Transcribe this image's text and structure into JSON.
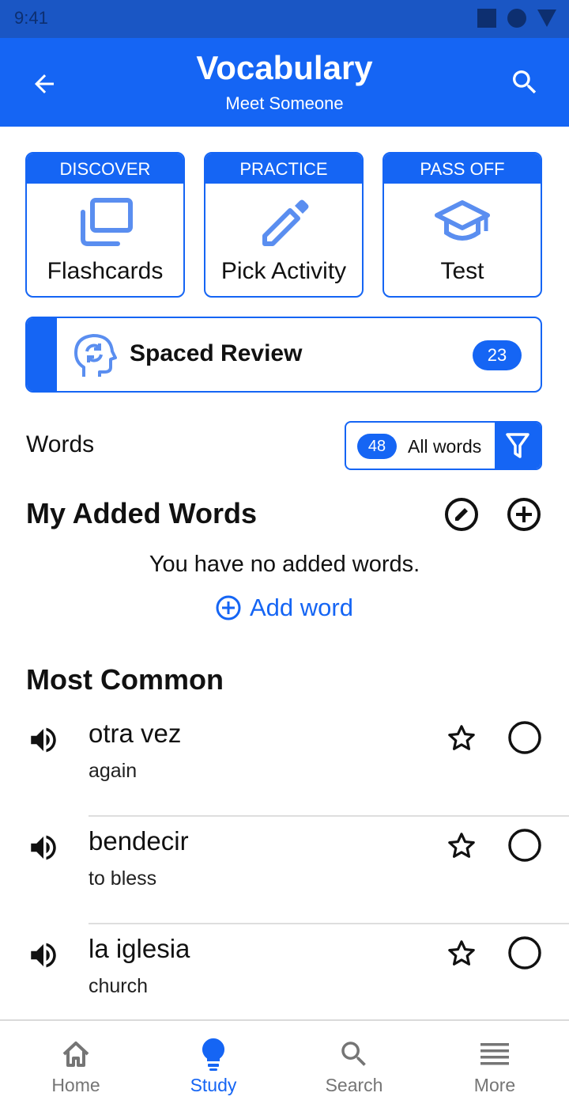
{
  "status_bar": {
    "time": "9:41"
  },
  "header": {
    "title": "Vocabulary",
    "subtitle": "Meet Someone",
    "back_icon": "arrow-left-icon",
    "search_icon": "search-icon"
  },
  "modes": [
    {
      "category": "DISCOVER",
      "label": "Flashcards",
      "icon": "cards-icon"
    },
    {
      "category": "PRACTICE",
      "label": "Pick Activity",
      "icon": "pencil-icon"
    },
    {
      "category": "PASS OFF",
      "label": "Test",
      "icon": "graduation-cap-icon"
    }
  ],
  "spaced_review": {
    "label": "Spaced Review",
    "count": "23",
    "icon": "head-refresh-icon"
  },
  "words": {
    "label": "Words",
    "count": "48",
    "filter_label": "All words",
    "filter_icon": "filter-icon"
  },
  "my_added_words": {
    "title": "My Added Words",
    "empty_message": "You have no added words.",
    "add_label": "Add word"
  },
  "most_common": {
    "title": "Most Common",
    "items": [
      {
        "term": "otra vez",
        "definition": "again"
      },
      {
        "term": "bendecir",
        "definition": "to bless"
      },
      {
        "term": "la iglesia",
        "definition": "church"
      }
    ]
  },
  "bottom_nav": {
    "items": [
      {
        "label": "Home",
        "icon": "home-icon"
      },
      {
        "label": "Study",
        "icon": "lightbulb-icon",
        "active": true
      },
      {
        "label": "Search",
        "icon": "search-icon"
      },
      {
        "label": "More",
        "icon": "menu-icon"
      }
    ]
  },
  "colors": {
    "primary": "#1565f4",
    "status_bar": "#1a56c4",
    "text": "#111111",
    "inactive": "#757575"
  }
}
